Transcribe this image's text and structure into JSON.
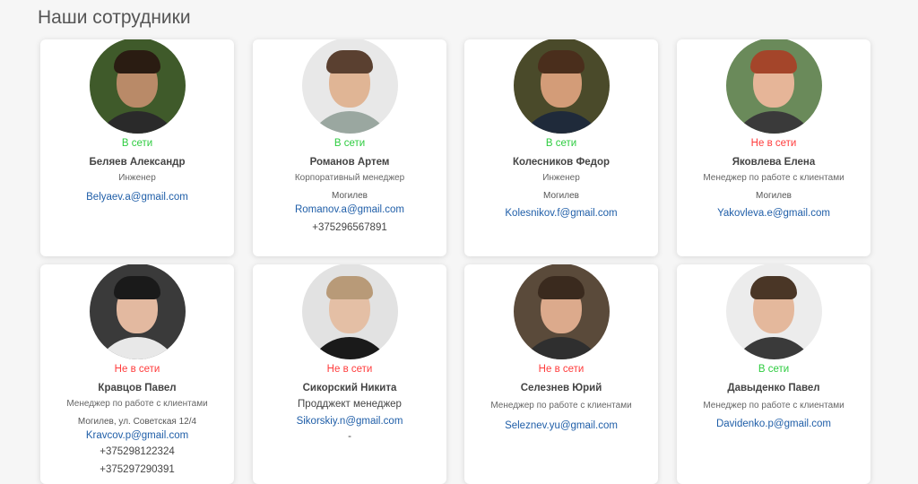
{
  "page": {
    "title": "Наши сотрудники"
  },
  "colors": {
    "online": "#2ecc40",
    "offline": "#ff3b3b",
    "link": "#1f5ea8"
  },
  "employees": [
    {
      "status": "В сети",
      "online": true,
      "name": "Беляев Александр",
      "position": "Инженер",
      "city": "",
      "email": "Belyaev.a@gmail.com",
      "phones": []
    },
    {
      "status": "В сети",
      "online": true,
      "name": "Романов Артем",
      "position": "Корпоративный менеджер",
      "city": "Могилев",
      "email": "Romanov.a@gmail.com",
      "phones": [
        "+375296567891"
      ]
    },
    {
      "status": "В сети",
      "online": true,
      "name": "Колесников Федор",
      "position": "Инженер",
      "city": "Могилев",
      "email": "Kolesnikov.f@gmail.com",
      "phones": []
    },
    {
      "status": "Не в сети",
      "online": false,
      "name": "Яковлева Елена",
      "position": "Менеджер по работе с клиентами",
      "city": "Могилев",
      "email": "Yakovleva.e@gmail.com",
      "phones": []
    },
    {
      "status": "Не в сети",
      "online": false,
      "name": "Кравцов Павел",
      "position": "Менеджер по работе с клиентами",
      "city": "Могилев, ул. Советская 12/4",
      "email": "Kravcov.p@gmail.com",
      "phones": [
        "+375298122324",
        "+375297290391"
      ]
    },
    {
      "status": "Не в сети",
      "online": false,
      "name": "Сикорский Никита",
      "position": "Продджект менеджер",
      "city": "",
      "email": "Sikorskiy.n@gmail.com",
      "phones": [],
      "extra": "-"
    },
    {
      "status": "Не в сети",
      "online": false,
      "name": "Селезнев Юрий",
      "position": "Менеджер по работе с клиентами",
      "city": "",
      "email": "Seleznev.yu@gmail.com",
      "phones": []
    },
    {
      "status": "В сети",
      "online": true,
      "name": "Давыденко Павел",
      "position": "Менеджер по работе с клиентами",
      "city": "",
      "email": "Davidenko.p@gmail.com",
      "phones": []
    }
  ]
}
